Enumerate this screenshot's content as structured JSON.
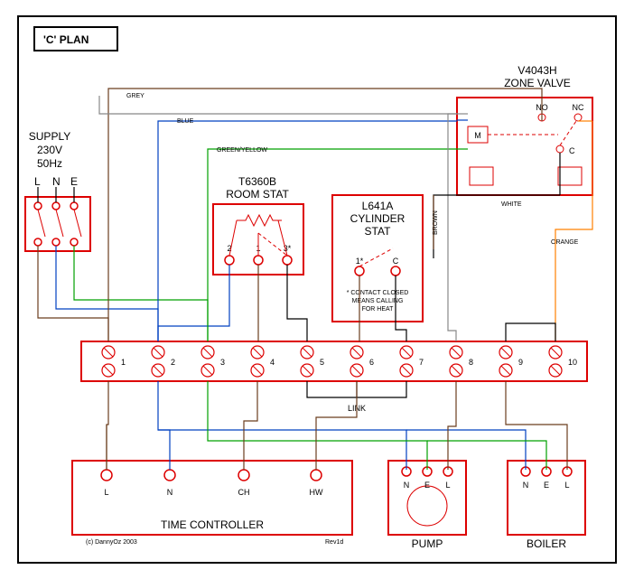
{
  "title": "'C' PLAN",
  "supply": {
    "label": "SUPPLY",
    "voltage": "230V",
    "freq": "50Hz",
    "L": "L",
    "N": "N",
    "E": "E"
  },
  "zone_valve": {
    "model": "V4043H",
    "label": "ZONE VALVE",
    "M": "M",
    "NO": "NO",
    "NC": "NC",
    "C": "C"
  },
  "room_stat": {
    "model": "T6360B",
    "label": "ROOM STAT",
    "t1": "1",
    "t2": "2",
    "t3": "3*"
  },
  "cylinder_stat": {
    "model": "L641A",
    "label": "CYLINDER",
    "label2": "STAT",
    "t1": "1*",
    "tC": "C",
    "note1": "* CONTACT CLOSED",
    "note2": "MEANS CALLING",
    "note3": "FOR HEAT"
  },
  "junction": {
    "t1": "1",
    "t2": "2",
    "t3": "3",
    "t4": "4",
    "t5": "5",
    "t6": "6",
    "t7": "7",
    "t8": "8",
    "t9": "9",
    "t10": "10",
    "link": "LINK"
  },
  "time_controller": {
    "label": "TIME CONTROLLER",
    "L": "L",
    "N": "N",
    "CH": "CH",
    "HW": "HW"
  },
  "pump": {
    "label": "PUMP",
    "N": "N",
    "E": "E",
    "L": "L"
  },
  "boiler": {
    "label": "BOILER",
    "N": "N",
    "E": "E",
    "L": "L"
  },
  "wire_labels": {
    "grey": "GREY",
    "blue": "BLUE",
    "greenyellow": "GREEN/YELLOW",
    "brown": "BROWN",
    "white": "WHITE",
    "orange": "ORANGE"
  },
  "footer": {
    "copyright": "(c) DannyOz 2003",
    "rev": "Rev1d"
  }
}
